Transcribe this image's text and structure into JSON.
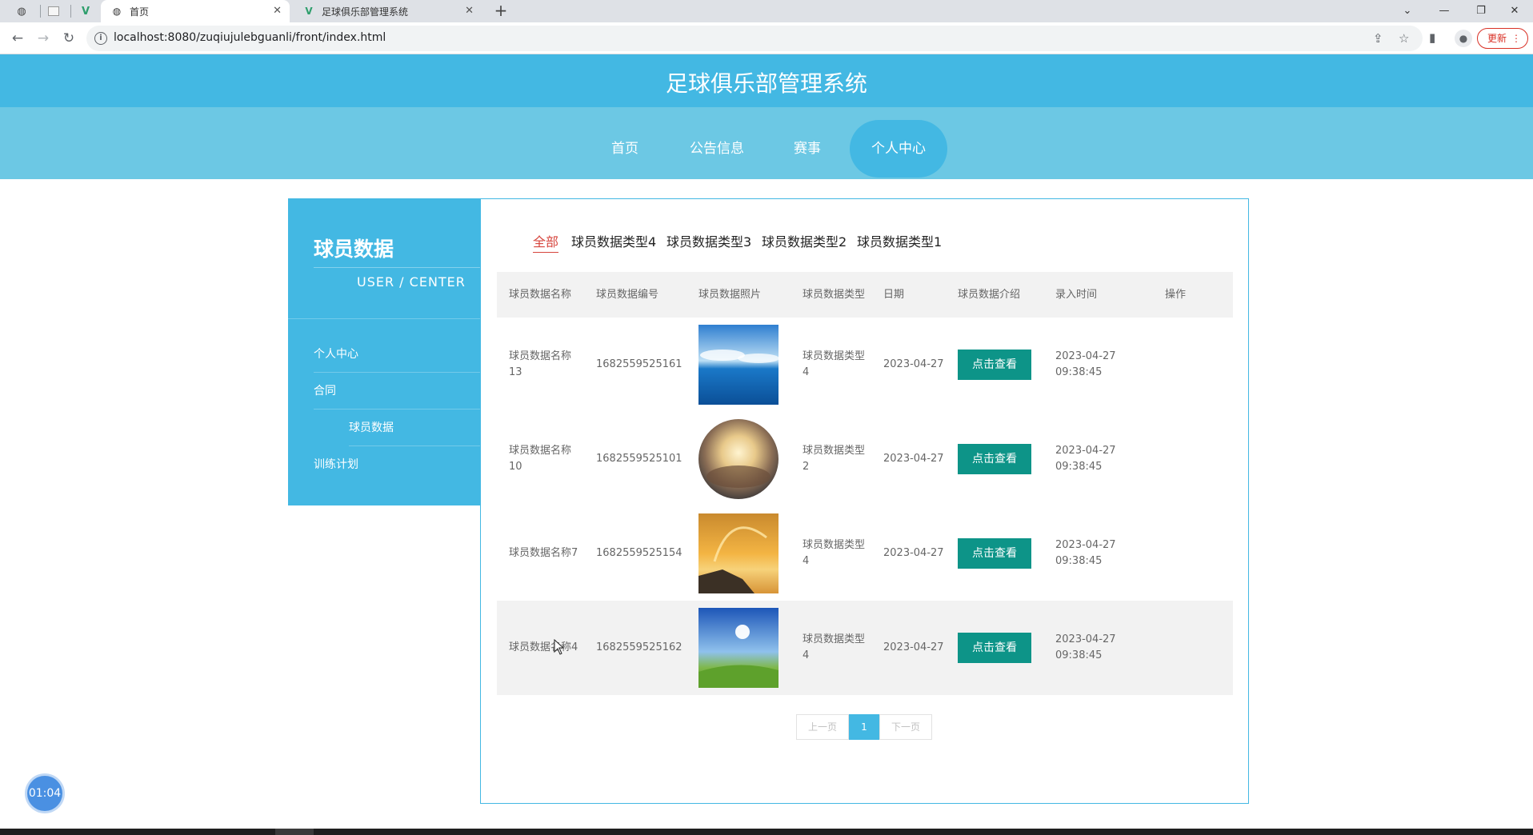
{
  "browser": {
    "tabs": [
      {
        "title": "首页",
        "active": true
      },
      {
        "title": "足球俱乐部管理系统",
        "active": false
      }
    ],
    "url": "localhost:8080/zuqiujulebguanli/front/index.html",
    "update_label": "更新",
    "update_menu": "⋮",
    "close_glyph": "✕",
    "new_tab_glyph": "+"
  },
  "header": {
    "title": "足球俱乐部管理系统"
  },
  "nav": {
    "items": [
      {
        "label": "首页"
      },
      {
        "label": "公告信息"
      },
      {
        "label": "赛事"
      },
      {
        "label": "个人中心",
        "active": true
      }
    ]
  },
  "sidebar": {
    "title": "球员数据",
    "subtitle": "USER / CENTER",
    "items": [
      {
        "label": "个人中心"
      },
      {
        "label": "合同"
      },
      {
        "label": "球员数据"
      },
      {
        "label": "训练计划"
      }
    ]
  },
  "filters": {
    "items": [
      {
        "label": "全部",
        "active": true
      },
      {
        "label": "球员数据类型4"
      },
      {
        "label": "球员数据类型3"
      },
      {
        "label": "球员数据类型2"
      },
      {
        "label": "球员数据类型1"
      }
    ]
  },
  "table": {
    "headers": [
      "球员数据名称",
      "球员数据编号",
      "球员数据照片",
      "球员数据类型",
      "日期",
      "球员数据介绍",
      "录入时间",
      "操作"
    ],
    "rows": [
      {
        "name": "球员数据名称13",
        "code": "1682559525161",
        "photo": "sea-sky",
        "type": "球员数据类型4",
        "date": "2023-04-27",
        "action": "点击查看",
        "time": "2023-04-27 09:38:45"
      },
      {
        "name": "球员数据名称10",
        "code": "1682559525101",
        "photo": "desert-sunset",
        "type": "球员数据类型2",
        "date": "2023-04-27",
        "action": "点击查看",
        "time": "2023-04-27 09:38:45"
      },
      {
        "name": "球员数据名称7",
        "code": "1682559525154",
        "photo": "rainbow-coast",
        "type": "球员数据类型4",
        "date": "2023-04-27",
        "action": "点击查看",
        "time": "2023-04-27 09:38:45"
      },
      {
        "name": "球员数据名称4",
        "code": "1682559525162",
        "photo": "grass-sky",
        "type": "球员数据类型4",
        "date": "2023-04-27",
        "action": "点击查看",
        "time": "2023-04-27 09:38:45"
      }
    ]
  },
  "pagination": {
    "prev": "上一页",
    "current": "1",
    "next": "下一页"
  },
  "timer": "01:04",
  "colors": {
    "primary": "#43b8e3",
    "nav": "#6cc8e4",
    "button": "#0d9488",
    "filter_active": "#d6453d"
  }
}
